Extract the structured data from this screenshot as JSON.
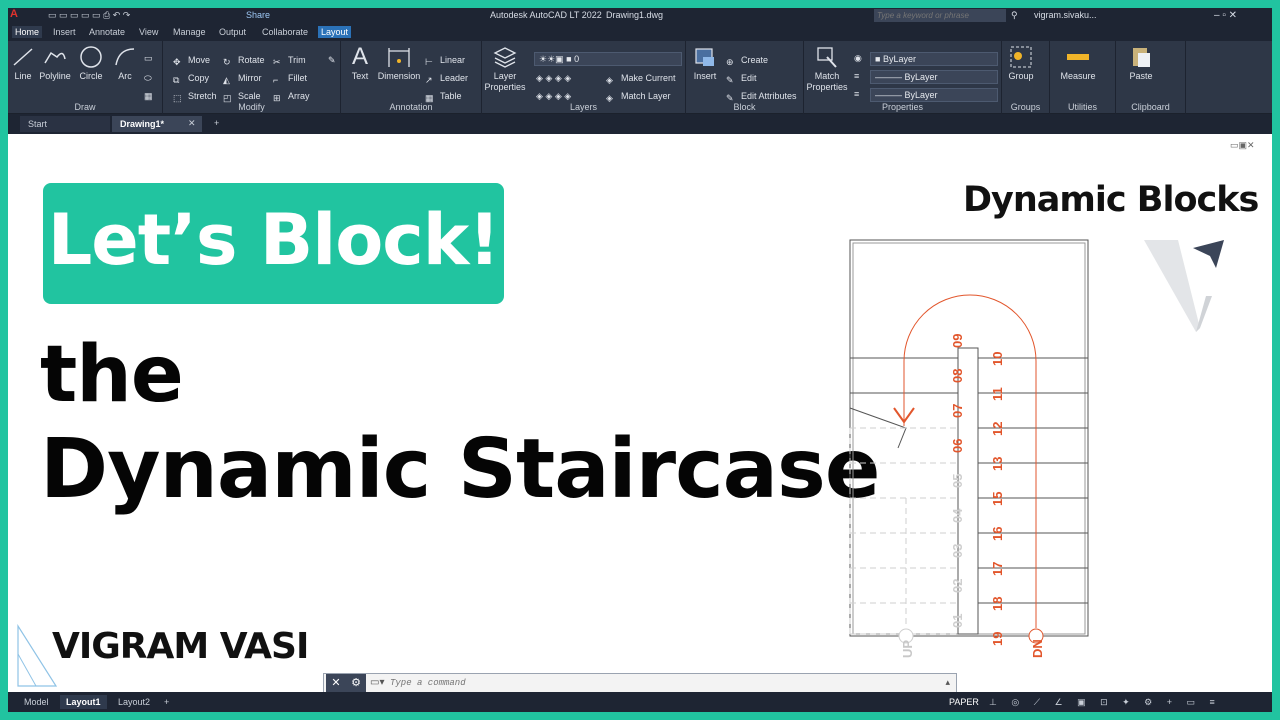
{
  "app": {
    "title": "Autodesk AutoCAD LT 2022",
    "file": "Drawing1.dwg",
    "share_label": "Share",
    "search_placeholder": "Type a keyword or phrase",
    "user": "vigram.sivaku..."
  },
  "ribbon_tabs": [
    "Home",
    "Insert",
    "Annotate",
    "View",
    "Manage",
    "Output",
    "Collaborate",
    "Layout"
  ],
  "panels": {
    "draw": {
      "label": "Draw",
      "buttons": [
        "Line",
        "Polyline",
        "Circle",
        "Arc"
      ]
    },
    "modify": {
      "label": "Modify",
      "items": [
        "Move",
        "Rotate",
        "Trim",
        "Copy",
        "Mirror",
        "Fillet",
        "Stretch",
        "Scale",
        "Array"
      ]
    },
    "annotation": {
      "label": "Annotation",
      "text": "Text",
      "dimension": "Dimension",
      "items": [
        "Linear",
        "Leader",
        "Table"
      ]
    },
    "layers": {
      "label": "Layers",
      "layer_props": "Layer Properties",
      "current_layer": "0",
      "make_current": "Make Current",
      "match_layer": "Match Layer"
    },
    "block": {
      "label": "Block",
      "insert": "Insert",
      "items": [
        "Create",
        "Edit",
        "Edit Attributes"
      ]
    },
    "properties": {
      "label": "Properties",
      "match": "Match Properties",
      "color": "ByLayer",
      "linetype": "ByLayer",
      "lineweight": "ByLayer"
    },
    "groups": {
      "label": "Groups",
      "group": "Group"
    },
    "utilities": {
      "label": "Utilities",
      "measure": "Measure"
    },
    "clipboard": {
      "label": "Clipboard",
      "paste": "Paste"
    }
  },
  "doc_tabs": [
    "Start",
    "Drawing1*"
  ],
  "layout_tabs": [
    "Model",
    "Layout1",
    "Layout2"
  ],
  "status": {
    "paper": "PAPER"
  },
  "command": {
    "placeholder": "Type a command"
  },
  "thumbnail": {
    "badge": "Let’s Block!",
    "line1": "the",
    "line2": "Dynamic Staircase",
    "brand": "Dynamic Blocks",
    "author": "VIGRAM VASI"
  },
  "stairs": {
    "up_label": "UP",
    "dn_label": "DN",
    "left_steps": [
      "01",
      "02",
      "03",
      "04",
      "05",
      "06",
      "07",
      "08",
      "09"
    ],
    "right_steps": [
      "10",
      "11",
      "12",
      "13",
      "15",
      "16",
      "17",
      "18",
      "19"
    ]
  },
  "colors": {
    "accent": "#21c4a0",
    "ribbon": "#2e3747",
    "stair_red": "#e2562c"
  }
}
